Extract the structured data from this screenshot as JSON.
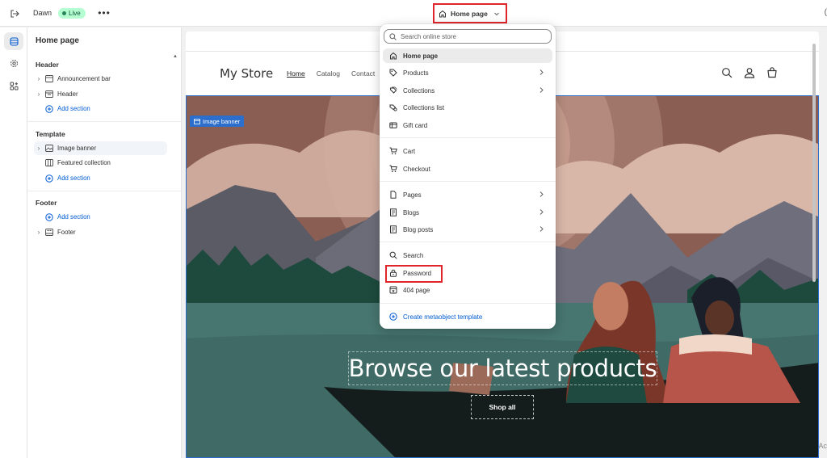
{
  "topbar": {
    "theme_name": "Dawn",
    "live_badge": "Live",
    "page_selector": "Home page",
    "right_cut": "("
  },
  "rail": {
    "items": [
      {
        "name": "sections-icon",
        "active": true
      },
      {
        "name": "settings-icon",
        "active": false
      },
      {
        "name": "apps-icon",
        "active": false
      }
    ]
  },
  "sidebar": {
    "title": "Home page",
    "header_group": {
      "label": "Header",
      "items": [
        "Announcement bar",
        "Header"
      ],
      "add": "Add section"
    },
    "template_group": {
      "label": "Template",
      "items": [
        "Image banner",
        "Featured collection"
      ],
      "add": "Add section"
    },
    "footer_group": {
      "label": "Footer",
      "add": "Add section",
      "items": [
        "Footer"
      ]
    }
  },
  "preview": {
    "store_name": "My Store",
    "nav": [
      "Home",
      "Catalog",
      "Contact"
    ],
    "banner_tag": "Image banner",
    "banner_heading": "Browse our latest products",
    "shop_button": "Shop all",
    "cut_text": "Ac"
  },
  "dropdown": {
    "search_placeholder": "Search online store",
    "groups": [
      [
        {
          "label": "Home page",
          "icon": "home-icon",
          "chevron": false,
          "selected": true
        },
        {
          "label": "Products",
          "icon": "tag-icon",
          "chevron": true
        },
        {
          "label": "Collections",
          "icon": "collection-icon",
          "chevron": true
        },
        {
          "label": "Collections list",
          "icon": "collections-list-icon",
          "chevron": false
        },
        {
          "label": "Gift card",
          "icon": "gift-card-icon",
          "chevron": false
        }
      ],
      [
        {
          "label": "Cart",
          "icon": "cart-icon",
          "chevron": false
        },
        {
          "label": "Checkout",
          "icon": "checkout-icon",
          "chevron": false
        }
      ],
      [
        {
          "label": "Pages",
          "icon": "page-icon",
          "chevron": true
        },
        {
          "label": "Blogs",
          "icon": "blog-icon",
          "chevron": true
        },
        {
          "label": "Blog posts",
          "icon": "blog-post-icon",
          "chevron": true
        }
      ],
      [
        {
          "label": "Search",
          "icon": "search-icon",
          "chevron": false
        },
        {
          "label": "Password",
          "icon": "lock-icon",
          "chevron": false
        },
        {
          "label": "404 page",
          "icon": "error-page-icon",
          "chevron": false
        }
      ]
    ],
    "create_label": "Create metaobject template"
  },
  "colors": {
    "accent": "#005bd3",
    "highlight": "#e0262b",
    "live_bg": "#b4fed2",
    "banner_outline": "#2c6ecb"
  }
}
